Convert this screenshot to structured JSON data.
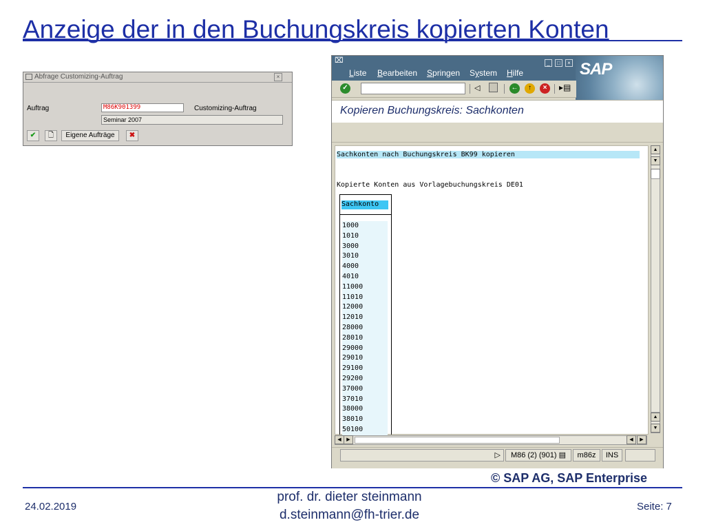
{
  "slide": {
    "title": "Anzeige der in den Buchungskreis kopierten Konten",
    "copyright": "© SAP AG, SAP Enterprise",
    "footer": {
      "date": "24.02.2019",
      "author_line1": "prof. dr. dieter steinmann",
      "author_line2": "d.steinmann@fh-trier.de",
      "page": "Seite: 7"
    }
  },
  "dialog": {
    "title": "Abfrage Customizing-Auftrag",
    "field_label": "Auftrag",
    "request_value": "M86K901399",
    "request_type": "Customizing-Auftrag",
    "description": "Seminar 2007",
    "own_requests_button": "Eigene Aufträge",
    "icons": [
      "check-icon",
      "new-document-icon",
      "cancel-icon"
    ]
  },
  "sap_window": {
    "menu": [
      "Liste",
      "Bearbeiten",
      "Springen",
      "System",
      "Hilfe"
    ],
    "menu_accel": [
      "L",
      "B",
      "S",
      "y",
      "H"
    ],
    "logo": "SAP",
    "screen_title": "Kopieren Buchungskreis: Sachkonten",
    "list": {
      "line1": "Sachkonten nach Buchungskreis BK99 kopieren",
      "line2": "Kopierte Konten aus Vorlagebuchungskreis DE01",
      "column_header": "Sachkonto",
      "accounts": [
        "1000",
        "1010",
        "3000",
        "3010",
        "4000",
        "4010",
        "11000",
        "11010",
        "12000",
        "12010",
        "28000",
        "28010",
        "29000",
        "29010",
        "29100",
        "29200",
        "37000",
        "37010",
        "38000",
        "38010",
        "50100"
      ]
    },
    "status": {
      "system": "M86 (2) (901)",
      "server": "m86z",
      "mode": "INS"
    },
    "colors": {
      "menubar": "#4a6b86",
      "highlight": "#b7e7f7",
      "column_header": "#3ec6f4"
    }
  }
}
